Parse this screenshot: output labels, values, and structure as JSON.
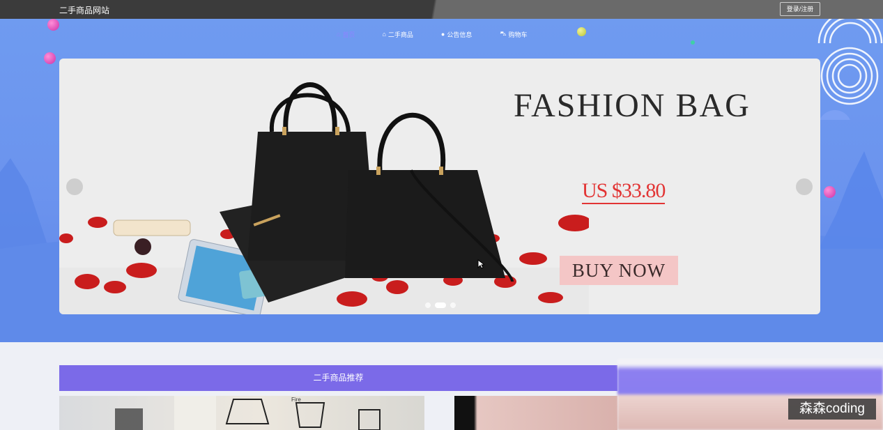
{
  "header": {
    "site_title": "二手商品网站",
    "login_label": "登录/注册"
  },
  "nav": {
    "items": [
      {
        "label": "首页",
        "icon": "home-icon"
      },
      {
        "label": "二手商品",
        "icon": "shop-icon"
      },
      {
        "label": "公告信息",
        "icon": "info-icon"
      },
      {
        "label": "购物车",
        "icon": "cart-icon"
      }
    ]
  },
  "banner": {
    "headline": "FASHION BAG",
    "price": "US $33.80",
    "cta": "BUY NOW"
  },
  "section": {
    "title": "二手商品推荐"
  },
  "watermark": "森森coding",
  "colors": {
    "accent": "#7b6ae8",
    "hero_bg": "#6b93ee",
    "topbar": "#3b3b3b",
    "price_red": "#e23434"
  }
}
